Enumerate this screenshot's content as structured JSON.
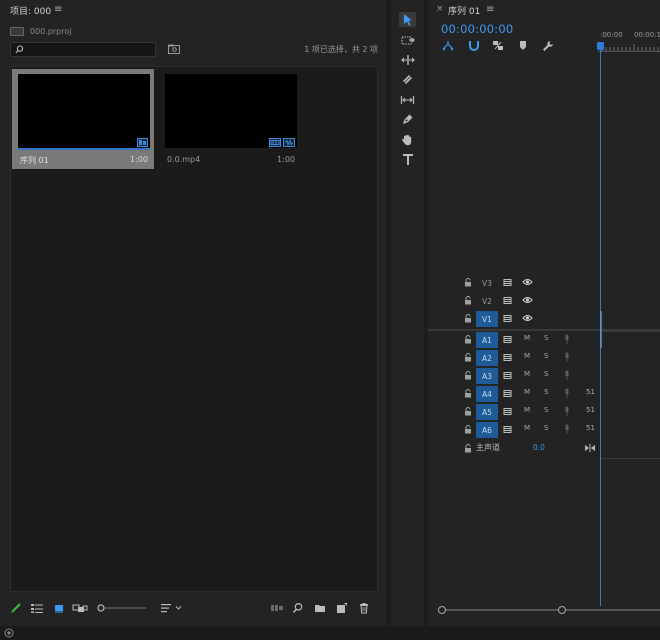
{
  "project": {
    "title": "项目: 000",
    "file_name": "000.prproj",
    "search_placeholder": "",
    "selection_status": "1 项已选择，共 2 项",
    "items": [
      {
        "name": "序列 01",
        "duration": "1:00",
        "type": "sequence",
        "selected": true
      },
      {
        "name": "0.0.mp4",
        "duration": "1:00",
        "type": "video",
        "selected": false
      }
    ]
  },
  "tools": [
    "selection-tool",
    "track-select-tool",
    "ripple-edit-tool",
    "razor-tool",
    "slip-tool",
    "pen-tool",
    "hand-tool",
    "type-tool"
  ],
  "timeline": {
    "title": "序列 01",
    "timecode": "00:00:00:00",
    "ruler_labels": [
      ":00:00",
      "00:00:1"
    ],
    "video_tracks": [
      {
        "name": "V3",
        "target": false
      },
      {
        "name": "V2",
        "target": false
      },
      {
        "name": "V1",
        "target": true
      }
    ],
    "audio_tracks": [
      {
        "name": "A1",
        "mute": "M",
        "solo": "S",
        "target": true,
        "vol": ""
      },
      {
        "name": "A2",
        "mute": "M",
        "solo": "S",
        "target": true,
        "vol": ""
      },
      {
        "name": "A3",
        "mute": "M",
        "solo": "S",
        "target": true,
        "vol": ""
      },
      {
        "name": "A4",
        "mute": "M",
        "solo": "S",
        "target": true,
        "vol": "51"
      },
      {
        "name": "A5",
        "mute": "M",
        "solo": "S",
        "target": true,
        "vol": "51"
      },
      {
        "name": "A6",
        "mute": "M",
        "solo": "S",
        "target": true,
        "vol": "51"
      }
    ],
    "master": {
      "label": "主声道",
      "value": "0.0"
    }
  },
  "colors": {
    "accent": "#3b9cf5",
    "track_target": "#1f5c97",
    "panel_bg": "#232323"
  }
}
